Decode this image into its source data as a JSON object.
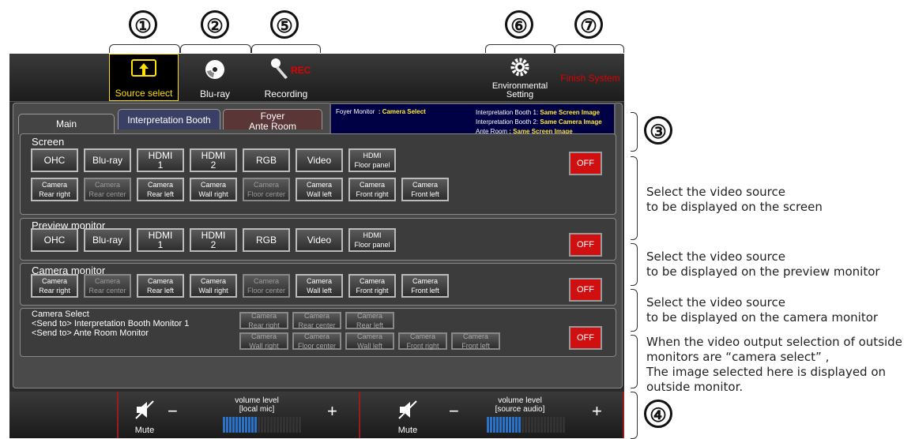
{
  "callouts": {
    "n1": "①",
    "n2": "②",
    "n3": "③",
    "n4": "④",
    "n5": "⑤",
    "n6": "⑥",
    "n7": "⑦"
  },
  "toolbar": {
    "source_select": "Source select",
    "bluray": "Blu-ray",
    "recording": "Recording",
    "rec_badge": "REC",
    "environmental_line1": "Environmental",
    "environmental_line2": "Setting",
    "finish_system": "Finish System"
  },
  "tabs": {
    "main": "Main",
    "booth": "Interpretation Booth",
    "foyer_line1": "Foyer",
    "foyer_line2": "Ante Room"
  },
  "status": {
    "foyer_label": "Foyer Monitor",
    "foyer_value": ": Camera Select",
    "booth1_label": "Interpretation Booth 1:",
    "booth1_value": "Same Screen Image",
    "booth2_label": "Interpretation Booth 2:",
    "booth2_value": "Same Camera Image",
    "ante_label": "Ante Room",
    "ante_value": ": Same Screen Image"
  },
  "screen": {
    "title": "Screen",
    "row1": [
      "OHC",
      "Blu-ray",
      "HDMI\n1",
      "HDMI\n2",
      "RGB",
      "Video",
      "HDMI\nFloor panel"
    ],
    "row2": [
      "Camera\nRear right",
      "Camera\nRear center",
      "Camera\nRear left",
      "Camera\nWall right",
      "Camera\nFloor center",
      "Camera\nWall left",
      "Camera\nFront right",
      "Camera\nFront left"
    ],
    "off": "OFF"
  },
  "preview": {
    "title": "Preview monitor",
    "row1": [
      "OHC",
      "Blu-ray",
      "HDMI\n1",
      "HDMI\n2",
      "RGB",
      "Video",
      "HDMI\nFloor panel"
    ],
    "off": "OFF"
  },
  "camera_monitor": {
    "title": "Camera monitor",
    "row1": [
      "Camera\nRear right",
      "Camera\nRear center",
      "Camera\nRear left",
      "Camera\nWall right",
      "Camera\nFloor center",
      "Camera\nWall left",
      "Camera\nFront right",
      "Camera\nFront left"
    ],
    "off": "OFF"
  },
  "camera_select": {
    "title": "Camera Select",
    "line1": "<Send to> Interpretation Booth Monitor 1",
    "line2": "<Send to> Ante Room Monitor",
    "row1": [
      "Camera\nRear right",
      "Camera\nRear center",
      "Camera\nRear left"
    ],
    "row2": [
      "Camera\nWall right",
      "Camera\nFloor center",
      "Camera\nWall left",
      "Camera\nFront right",
      "Camera\nFront left"
    ],
    "off": "OFF"
  },
  "volume": {
    "mute": "Mute",
    "left_title1": "volume level",
    "left_title2": "[local mic]",
    "right_title1": "volume level",
    "right_title2": "[source audio]",
    "minus": "−",
    "plus": "+",
    "left_level": 0.44,
    "right_level": 0.44
  },
  "annotations": {
    "screen1": "Select the video source",
    "screen2": "to be displayed on the screen",
    "preview1": "Select the video source",
    "preview2": "to be displayed on the preview monitor",
    "cammon1": "Select the video source",
    "cammon2": "to be displayed on the camera monitor",
    "camsel1": "When the video output selection of outside",
    "camsel2": "monitors are “camera select” ,",
    "camsel3": "The image selected here is displayed on",
    "camsel4": "outside monitor."
  },
  "colors": {
    "active_yellow": "#ffe000",
    "off_red": "#d01010",
    "finish_red": "#e00000",
    "meter_blue": "#2a72c8"
  }
}
